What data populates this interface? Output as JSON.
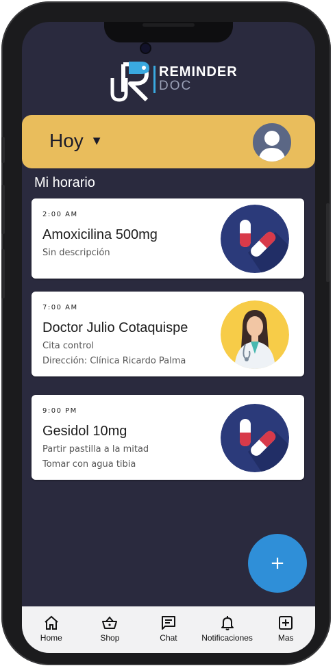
{
  "brand": {
    "name_top": "REMINDER",
    "name_bottom": "DOC"
  },
  "header": {
    "date_filter_label": "Hoy"
  },
  "section_title": "Mi horario",
  "schedule": [
    {
      "time": "2:00 AM",
      "title": "Amoxicilina 500mg",
      "lines": [
        "Sin descripción"
      ],
      "image": "pill-icon"
    },
    {
      "time": "7:00 AM",
      "title": "Doctor Julio Cotaquispe",
      "lines": [
        "Cita control",
        "Dirección: Clínica Ricardo Palma"
      ],
      "image": "doctor-avatar"
    },
    {
      "time": "9:00 PM",
      "title": "Gesidol 10mg",
      "lines": [
        "Partir pastilla a la mitad",
        "Tomar con agua tibia"
      ],
      "image": "pill-icon"
    }
  ],
  "fab": {
    "label": "+"
  },
  "nav": [
    {
      "label": "Home",
      "icon": "home-icon"
    },
    {
      "label": "Shop",
      "icon": "shop-basket-icon"
    },
    {
      "label": "Chat",
      "icon": "chat-icon"
    },
    {
      "label": "Notificaciones",
      "icon": "bell-icon"
    },
    {
      "label": "Mas",
      "icon": "plus-square-icon"
    }
  ],
  "colors": {
    "background": "#2a2a3e",
    "header_bar": "#e9bd5c",
    "accent": "#3aa9e0",
    "fab": "#2f8fd8",
    "card": "#ffffff"
  }
}
